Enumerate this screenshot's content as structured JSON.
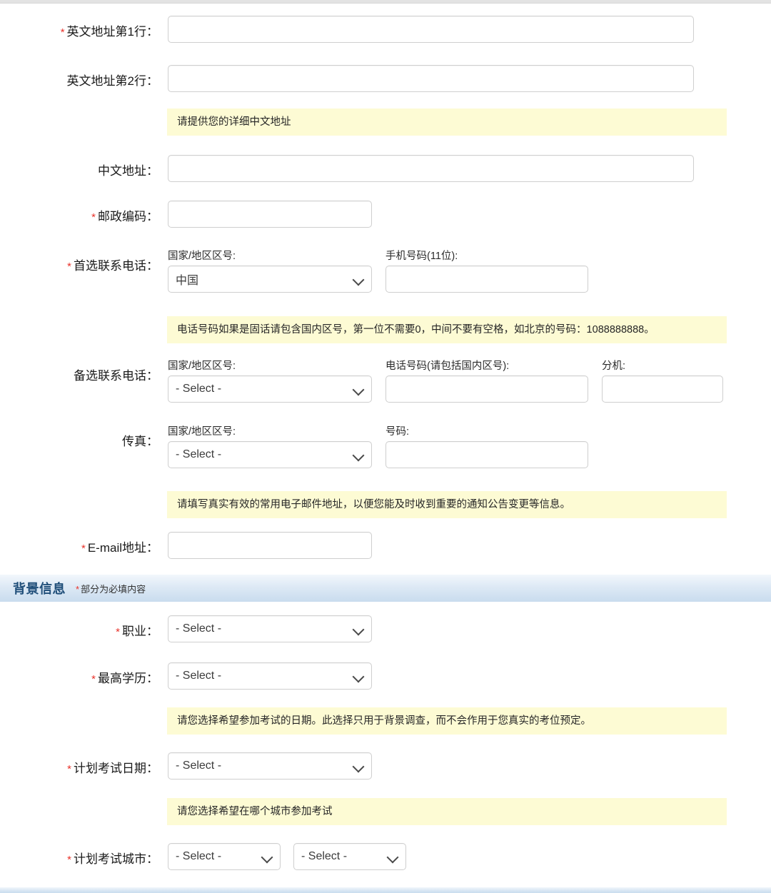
{
  "form": {
    "rows": [
      {
        "key": "addr_en_1",
        "label": "英文地址第1行：",
        "required": true,
        "type": "text",
        "value": ""
      },
      {
        "key": "addr_en_2",
        "label": "英文地址第2行：",
        "required": false,
        "type": "text",
        "value": ""
      },
      {
        "key": "addr_cn",
        "label": "中文地址：",
        "required": false,
        "type": "text",
        "value": ""
      },
      {
        "key": "postcode",
        "label": "邮政编码：",
        "required": true,
        "type": "text",
        "value": ""
      },
      {
        "key": "phone1",
        "label": "首选联系电话：",
        "required": true,
        "type": "group",
        "value": ""
      },
      {
        "key": "phone2",
        "label": "备选联系电话：",
        "required": false,
        "type": "group",
        "value": ""
      },
      {
        "key": "fax",
        "label": "传真：",
        "required": false,
        "type": "group",
        "value": ""
      },
      {
        "key": "email",
        "label": "E-mail地址：",
        "required": true,
        "type": "text",
        "value": ""
      },
      {
        "key": "occupation",
        "label": "职业：",
        "required": true,
        "type": "select",
        "value": "- Select -"
      },
      {
        "key": "education",
        "label": "最高学历：",
        "required": true,
        "type": "select",
        "value": "- Select -"
      },
      {
        "key": "exam_date",
        "label": "计划考试日期：",
        "required": true,
        "type": "select",
        "value": "- Select -"
      },
      {
        "key": "exam_city",
        "label": "计划考试城市：",
        "required": true,
        "type": "select2",
        "value": "- Select -"
      }
    ],
    "hints": [
      {
        "key": "hint_addr",
        "text": "请提供您的详细中文地址"
      },
      {
        "key": "hint_phone",
        "text": "电话号码如果是固话请包含国内区号，第一位不需要0，中间不要有空格，如北京的号码：1088888888。"
      },
      {
        "key": "hint_email",
        "text": "请填写真实有效的常用电子邮件地址，以便您能及时收到重要的通知公告变更等信息。"
      },
      {
        "key": "hint_date",
        "text": "请您选择希望参加考试的日期。此选择只用于背景调查，而不会作用于您真实的考位预定。"
      },
      {
        "key": "hint_city",
        "text": "请您选择希望在哪个城市参加考试"
      }
    ],
    "sub_captions": {
      "country_code": "国家/地区区号:",
      "mobile_11": "手机号码(11位):",
      "phone_with_area": "电话号码(请包括国内区号):",
      "extension": "分机:",
      "fax_number": "号码:"
    },
    "selects": {
      "country_china": "中国",
      "placeholder": "- Select -"
    }
  },
  "section": {
    "title": "背景信息",
    "note": "部分为必填内容",
    "note_marker": "*"
  },
  "colors": {
    "required_star": "#e8322a",
    "hint_bg": "#fdfbd4",
    "section_text": "#1f4e79",
    "input_border": "#cfcfcf"
  }
}
